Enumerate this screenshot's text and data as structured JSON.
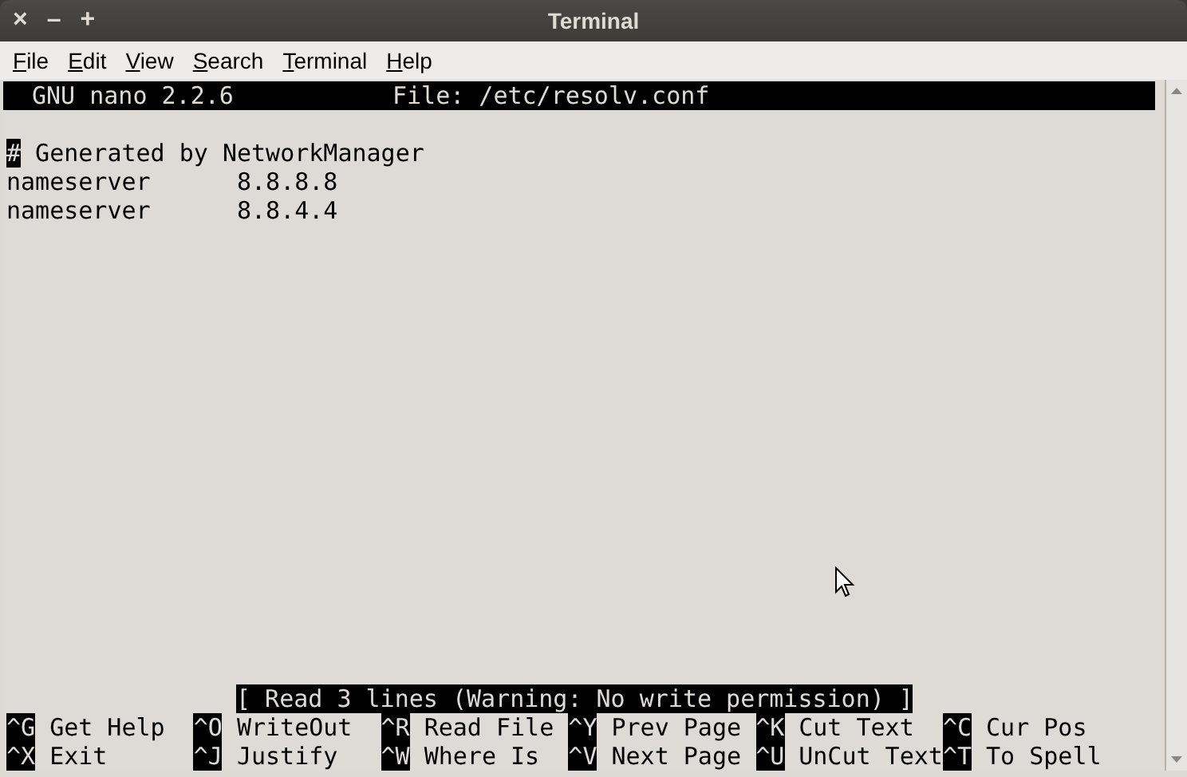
{
  "window": {
    "title": "Terminal",
    "controls": [
      "×",
      "–",
      "+"
    ]
  },
  "menu": [
    "File",
    "Edit",
    "View",
    "Search",
    "Terminal",
    "Help"
  ],
  "nano": {
    "header_left": "GNU nano 2.2.6",
    "header_file": "File: /etc/resolv.conf",
    "lines": [
      {
        "text": "# Generated by NetworkManager",
        "cursor": true
      },
      {
        "text": "nameserver      8.8.8.8",
        "cursor": false
      },
      {
        "text": "nameserver      8.8.4.4",
        "cursor": false
      }
    ],
    "status": "[ Read 3 lines (Warning: No write permission) ]",
    "shortcuts": [
      [
        {
          "key": "^G",
          "label": "Get Help"
        },
        {
          "key": "^O",
          "label": "WriteOut"
        },
        {
          "key": "^R",
          "label": "Read File"
        },
        {
          "key": "^Y",
          "label": "Prev Page"
        },
        {
          "key": "^K",
          "label": "Cut Text"
        },
        {
          "key": "^C",
          "label": "Cur Pos"
        }
      ],
      [
        {
          "key": "^X",
          "label": "Exit"
        },
        {
          "key": "^J",
          "label": "Justify"
        },
        {
          "key": "^W",
          "label": "Where Is"
        },
        {
          "key": "^V",
          "label": "Next Page"
        },
        {
          "key": "^U",
          "label": "UnCut Text"
        },
        {
          "key": "^T",
          "label": "To Spell"
        }
      ]
    ]
  }
}
